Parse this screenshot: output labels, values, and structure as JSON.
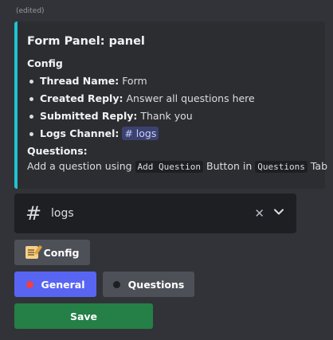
{
  "message": {
    "edited_label": "(edited)"
  },
  "embed": {
    "title": "Form Panel: panel",
    "config_heading": "Config",
    "fields": [
      {
        "label": "Thread Name:",
        "value": "Form"
      },
      {
        "label": "Created Reply:",
        "value": "Answer all questions here"
      },
      {
        "label": "Submitted Reply:",
        "value": "Thank you"
      },
      {
        "label": "Logs Channel:",
        "value": "# logs"
      }
    ],
    "questions_heading": "Questions:",
    "questions_text": {
      "part1": "Add a question using",
      "code1": "Add Question",
      "part2": "Button in",
      "code2": "Questions",
      "part3": "Tab"
    },
    "accent_color": "#21c3cf"
  },
  "channel_select": {
    "icon": "hash-icon",
    "value": "logs",
    "clear_icon": "close-icon",
    "expand_icon": "chevron-down-icon"
  },
  "buttons": {
    "config": {
      "label": "Config",
      "icon": "memo-emoji-icon"
    },
    "general": {
      "label": "General",
      "icon": "red-circle-icon",
      "color": "#5865f2"
    },
    "questions": {
      "label": "Questions",
      "icon": "black-circle-icon"
    },
    "save": {
      "label": "Save",
      "color": "#248046"
    }
  }
}
